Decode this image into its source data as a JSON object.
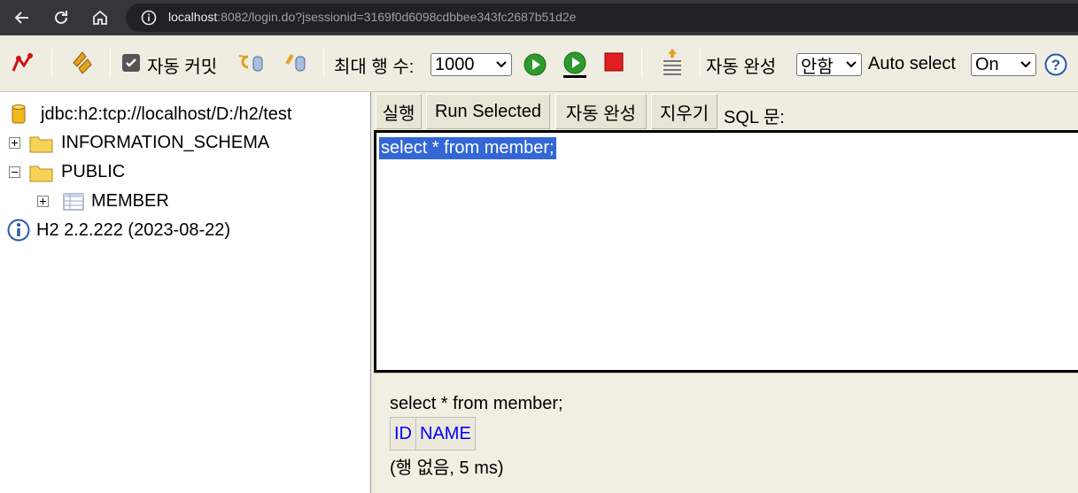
{
  "browser": {
    "url_host": "localhost",
    "url_rest": ":8082/login.do?jsessionid=3169f0d6098cdbbee343fc2687b51d2e"
  },
  "toolbar": {
    "autocommit_label": "자동 커밋",
    "max_rows_label": "최대 행 수:",
    "max_rows_value": "1000",
    "autocomplete_label": "자동 완성",
    "autocomplete_value": "안함",
    "autoselect_label": "Auto select",
    "autoselect_value": "On"
  },
  "tree": {
    "connection": "jdbc:h2:tcp://localhost/D:/h2/test",
    "schema_info": "INFORMATION_SCHEMA",
    "schema_public": "PUBLIC",
    "table_member": "MEMBER",
    "version": "H2 2.2.222 (2023-08-22)"
  },
  "buttons": {
    "run": "실행",
    "run_selected": "Run Selected",
    "autocomplete": "자동 완성",
    "clear": "지우기",
    "sql_label": "SQL 문:"
  },
  "editor": {
    "text": "select * from member;"
  },
  "result": {
    "query": "select * from member;",
    "columns": [
      "ID",
      "NAME"
    ],
    "footer": "(행 없음, 5 ms)"
  },
  "colors": {
    "toolbar_bg": "#efece1",
    "selection": "#3367d6",
    "link_blue": "#0000ff"
  }
}
